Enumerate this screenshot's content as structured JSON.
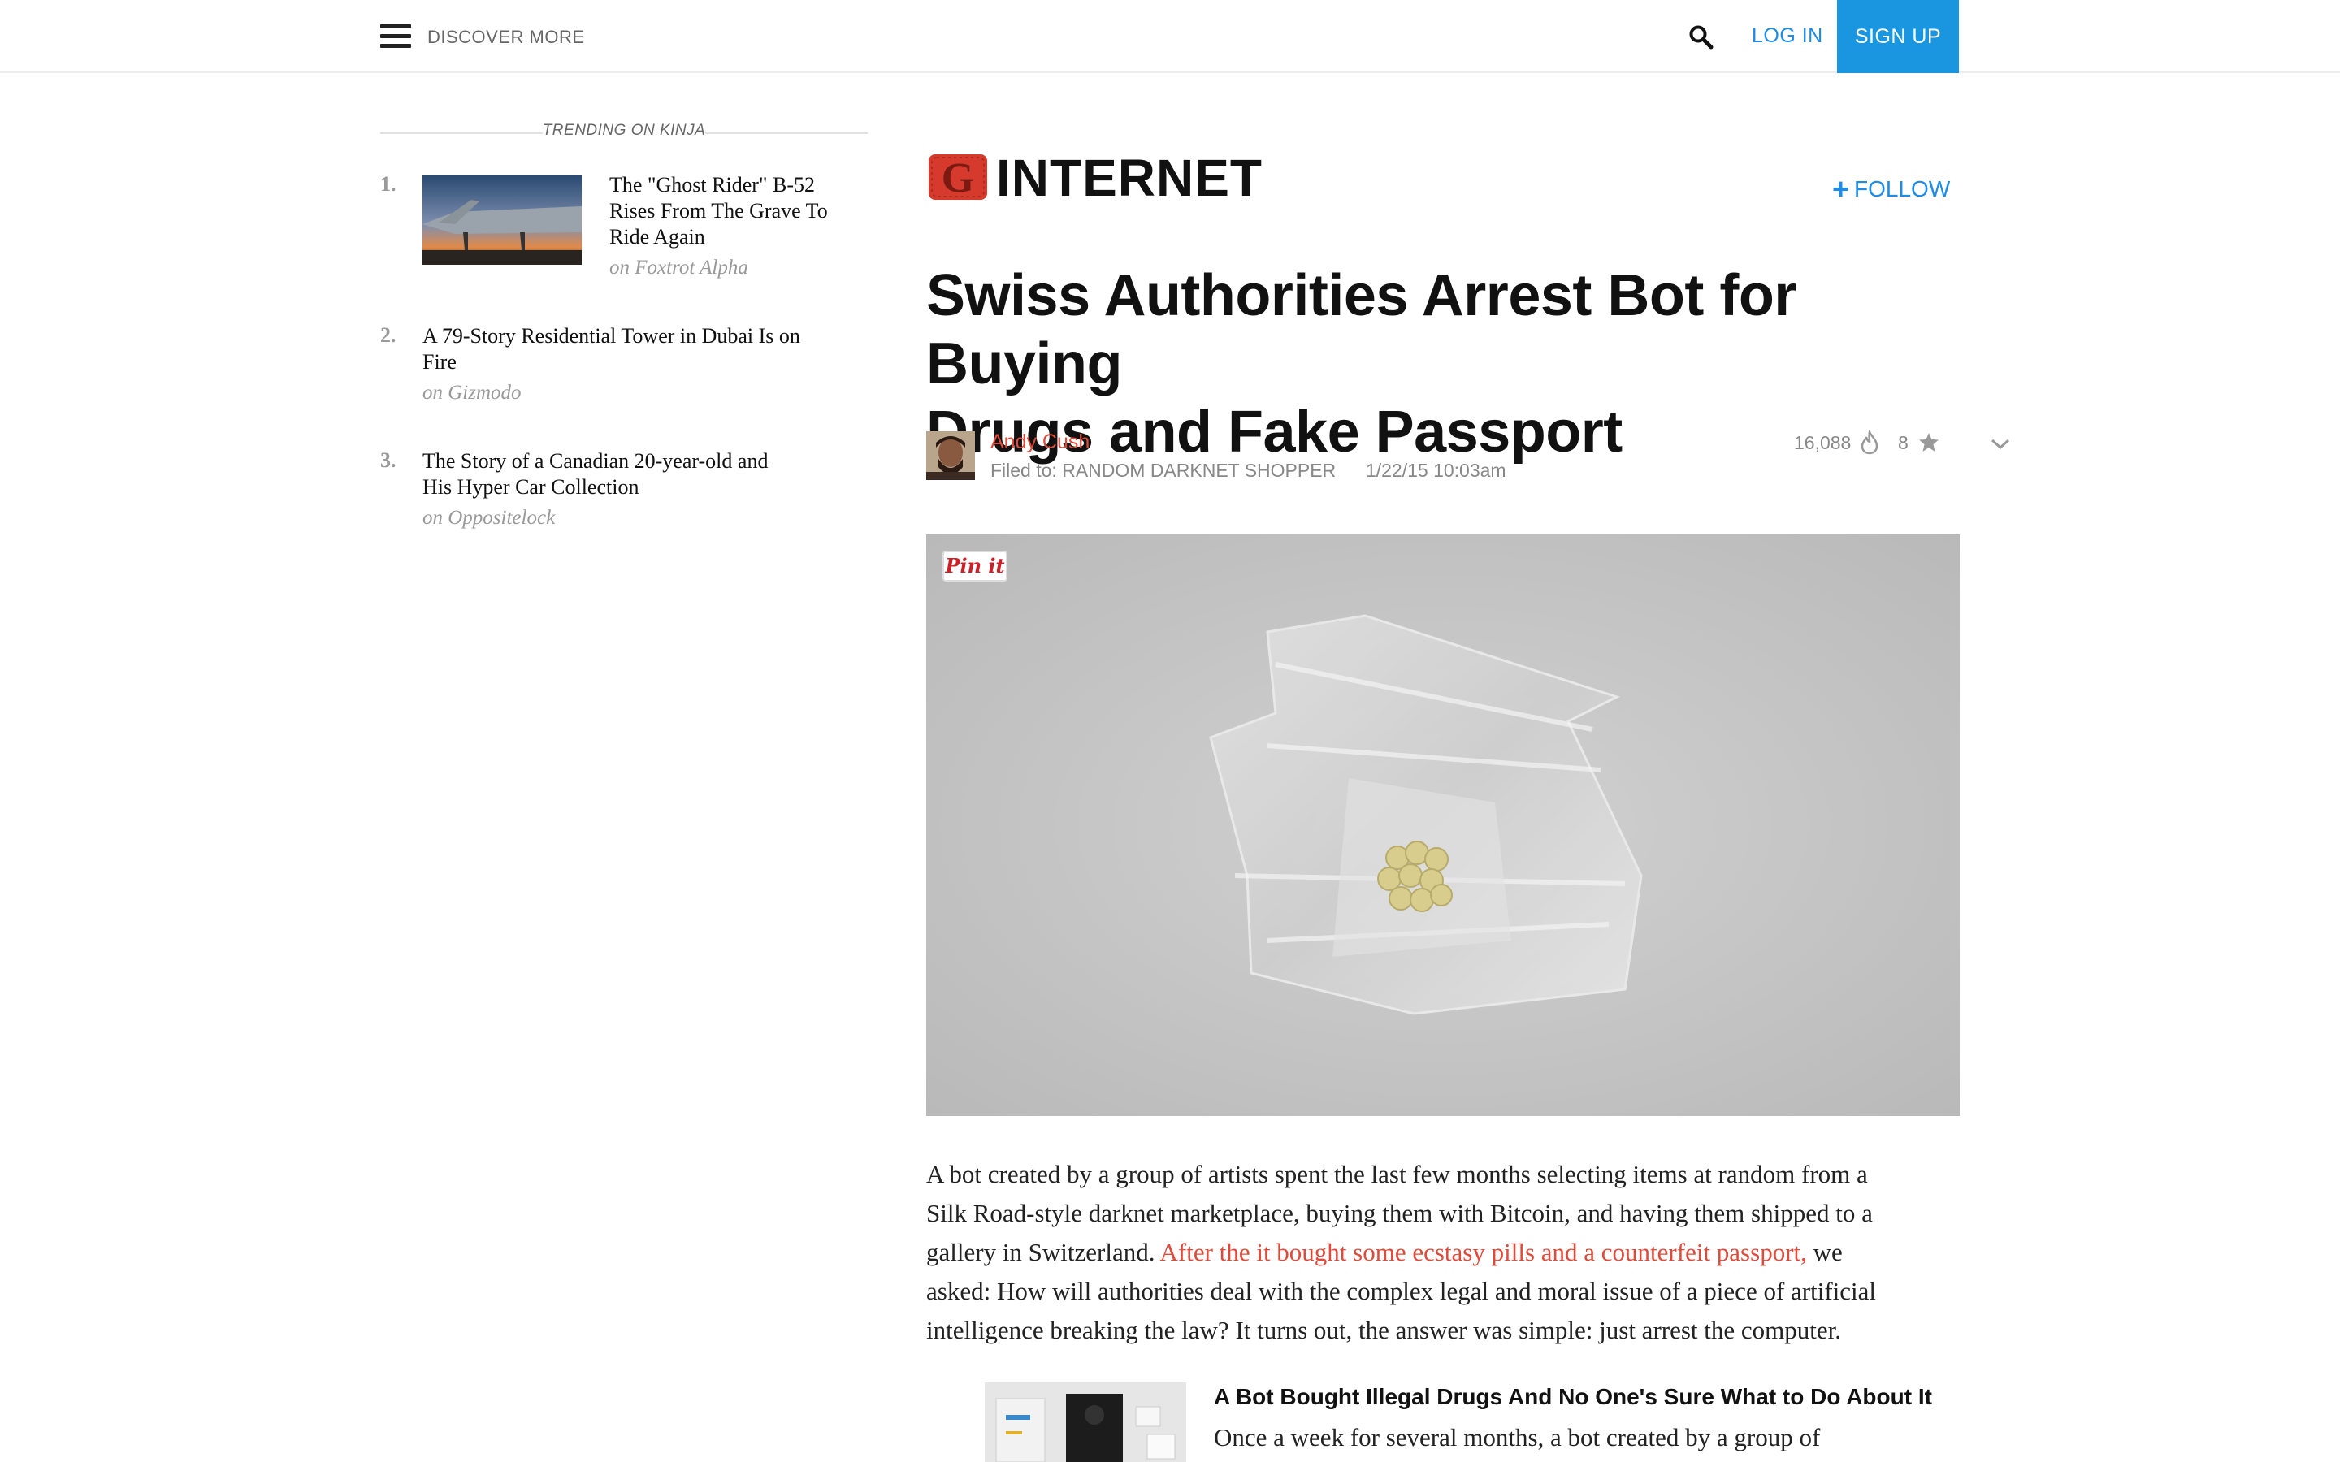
{
  "topbar": {
    "discover_label": "DISCOVER MORE",
    "login_label": "LOG IN",
    "signup_label": "SIGN UP"
  },
  "trending": {
    "heading": "TRENDING ON KINJA",
    "items": [
      {
        "number": "1.",
        "title_lines": [
          "The \"Ghost Rider\" B-52",
          "Rises From The Grave To",
          "Ride Again"
        ],
        "source": "on Foxtrot Alpha"
      },
      {
        "number": "2.",
        "title_lines": [
          "A 79-Story Residential Tower in Dubai Is on",
          "Fire"
        ],
        "source": "on Gizmodo"
      },
      {
        "number": "3.",
        "title_lines": [
          "The Story of a Canadian 20-year-old and",
          "His Hyper Car Collection"
        ],
        "source": "on Oppositelock"
      }
    ]
  },
  "section": {
    "logo_letter": "G",
    "name": "INTERNET",
    "follow_label": "FOLLOW"
  },
  "article": {
    "headline_lines": [
      "Swiss Authorities Arrest Bot for Buying",
      "Drugs and Fake Passport"
    ],
    "author": "Andy Cush",
    "filed_to": "Filed to: RANDOM DARKNET SHOPPER",
    "date": "1/22/15 10:03am",
    "views": "16,088",
    "likes": "8",
    "pinit_label": "Pin it",
    "body_lines": [
      "A bot created by a group of artists spent the last few months selecting items at random from a",
      "Silk Road-style darknet marketplace, buying them with Bitcoin, and having them shipped to a",
      "gallery in Switzerland. ",
      "asked: How will authorities deal with the complex legal and moral issue of a piece of artificial",
      "intelligence breaking the law? It turns out, the answer was simple: just arrest the computer."
    ],
    "body_link": "After the it bought some ecstasy pills and a counterfeit passport,",
    "body_after_link": " we",
    "related_title": "A Bot Bought Illegal Drugs And No One's Sure What to Do About It",
    "related_snippet": "Once a week for several months, a bot created by a group of"
  },
  "colors": {
    "accent_blue": "#1d8be8",
    "signup_bg": "#1a95e0",
    "author_red": "#e04a3a",
    "logo_red": "#d63a2c"
  }
}
